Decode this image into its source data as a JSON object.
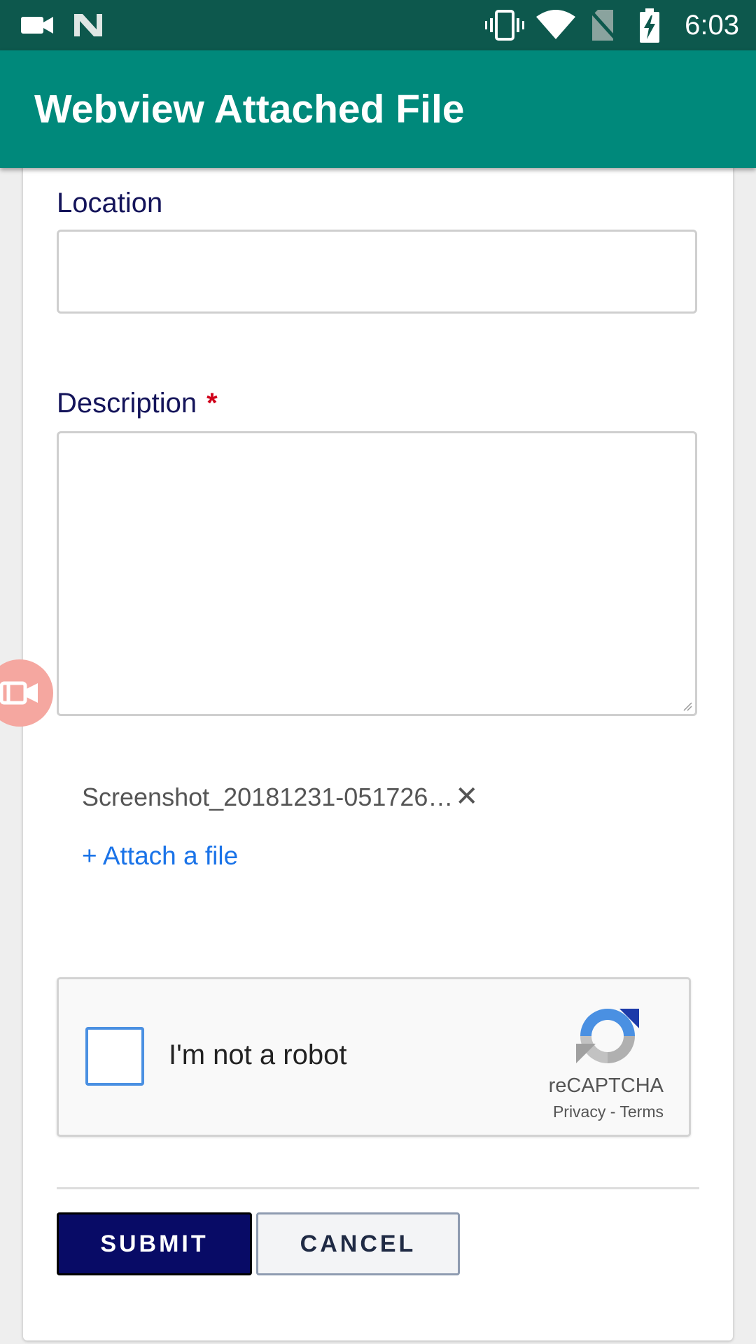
{
  "status_bar": {
    "time": "6:03",
    "icons": [
      "video-camera-icon",
      "n-notification-icon",
      "vibrate-icon",
      "wifi-icon",
      "no-sim-icon",
      "battery-charging-icon"
    ]
  },
  "app_bar": {
    "title": "Webview Attached File"
  },
  "form": {
    "location": {
      "label": "Location",
      "value": ""
    },
    "description": {
      "label": "Description",
      "required_mark": "*",
      "value": ""
    },
    "attachment": {
      "file_name": "Screenshot_20181231-051726…",
      "remove_symbol": "✕",
      "attach_link": "+ Attach a file"
    },
    "captcha": {
      "checkbox_label": "I'm not a robot",
      "brand": "reCAPTCHA",
      "privacy": "Privacy",
      "separator": " - ",
      "terms": "Terms",
      "checked": false
    },
    "buttons": {
      "submit": "SUBMIT",
      "cancel": "CANCEL"
    }
  },
  "colors": {
    "status_bar": "#0d584d",
    "app_bar": "#00897b",
    "submit": "#080b66",
    "link": "#1a73e8",
    "label": "#14145a",
    "required": "#d0021b"
  },
  "floating_button": {
    "icon": "screen-record-icon"
  }
}
